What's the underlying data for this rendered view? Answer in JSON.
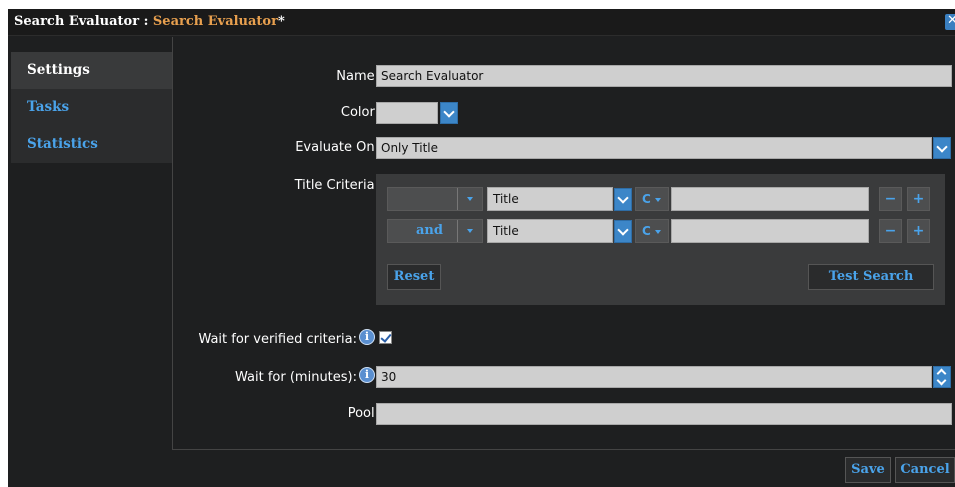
{
  "title": {
    "prefix": "Search Evaluator : ",
    "name": "Search Evaluator",
    "modified": "*"
  },
  "close_icon": "close-icon",
  "sidebar": {
    "items": [
      {
        "label": "Settings",
        "active": true
      },
      {
        "label": "Tasks",
        "active": false
      },
      {
        "label": "Statistics",
        "active": false
      }
    ]
  },
  "form": {
    "name_label": "Name:",
    "name_value": "Search Evaluator",
    "color_label": "Color:",
    "evaluate_label": "Evaluate On:",
    "evaluate_value": "Only Title",
    "criteria_label": "Title Criteria:",
    "criteria_rows": [
      {
        "logic": "",
        "field": "Title",
        "case": "C",
        "value": ""
      },
      {
        "logic": "and",
        "field": "Title",
        "case": "C",
        "value": ""
      }
    ],
    "remove_label": "−",
    "add_label": "+",
    "reset_label": "Reset",
    "test_search_label": "Test Search",
    "wait_verified_label": "Wait for verified criteria:",
    "wait_verified_checked": true,
    "wait_minutes_label": "Wait for (minutes):",
    "wait_minutes_value": "30",
    "pool_label": "Pool:",
    "pool_value": ""
  },
  "footer": {
    "save_label": "Save",
    "cancel_label": "Cancel"
  },
  "colors": {
    "accent": "#4aa3ea",
    "title_accent": "#e8a04f",
    "background": "#1e1f20"
  }
}
